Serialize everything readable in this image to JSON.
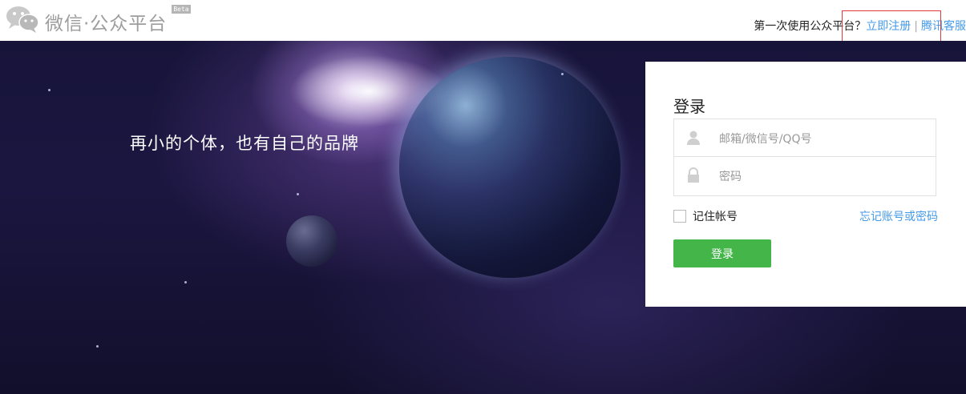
{
  "header": {
    "logo_text": "微信·公众平台",
    "beta_badge": "Beta",
    "first_time_text": "第一次使用公众平台？",
    "register_link": "立即注册",
    "separator": "|",
    "service_link": "腾讯客服"
  },
  "banner": {
    "slogan": "再小的个体，也有自己的品牌"
  },
  "login": {
    "title": "登录",
    "username_placeholder": "邮箱/微信号/QQ号",
    "password_placeholder": "密码",
    "remember_label": "记住帐号",
    "forgot_link": "忘记账号或密码",
    "submit_label": "登录"
  },
  "icons": {
    "logo": "wechat-logo-icon",
    "user": "user-icon",
    "lock": "lock-icon"
  },
  "colors": {
    "accent": "#44b549",
    "link": "#459ae9",
    "highlight_box": "#e03a3a"
  }
}
